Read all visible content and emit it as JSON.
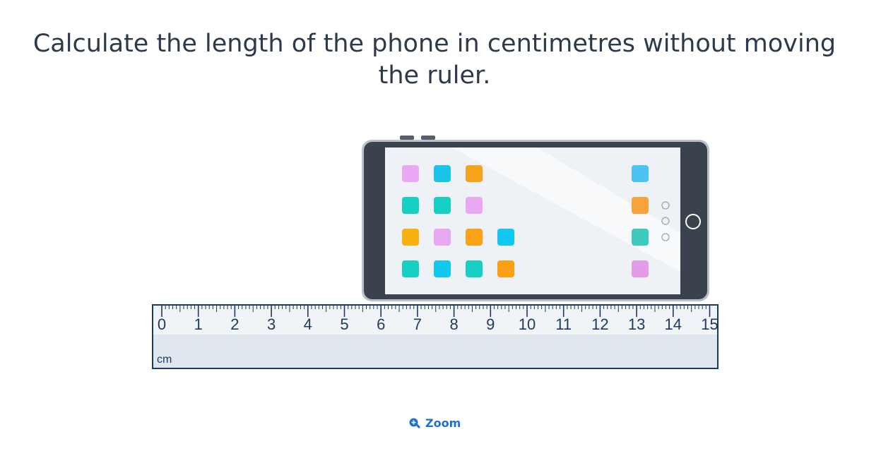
{
  "question": {
    "text": "Calculate the length of the phone in centimetres without moving the ruler."
  },
  "ruler": {
    "unit_label": "cm",
    "numbers": [
      "0",
      "1",
      "2",
      "3",
      "4",
      "5",
      "6",
      "7",
      "8",
      "9",
      "10",
      "11",
      "12",
      "13",
      "14",
      "15"
    ],
    "max_cm": 15
  },
  "zoom": {
    "label": "Zoom",
    "icon": "zoom-in-icon"
  },
  "colors": {
    "text": "#2c3a4b",
    "ruler_border": "#1d3a5f",
    "ruler_fill": "#dfe6ee",
    "phone_body": "#3d4650",
    "link": "#1f6fd1"
  }
}
